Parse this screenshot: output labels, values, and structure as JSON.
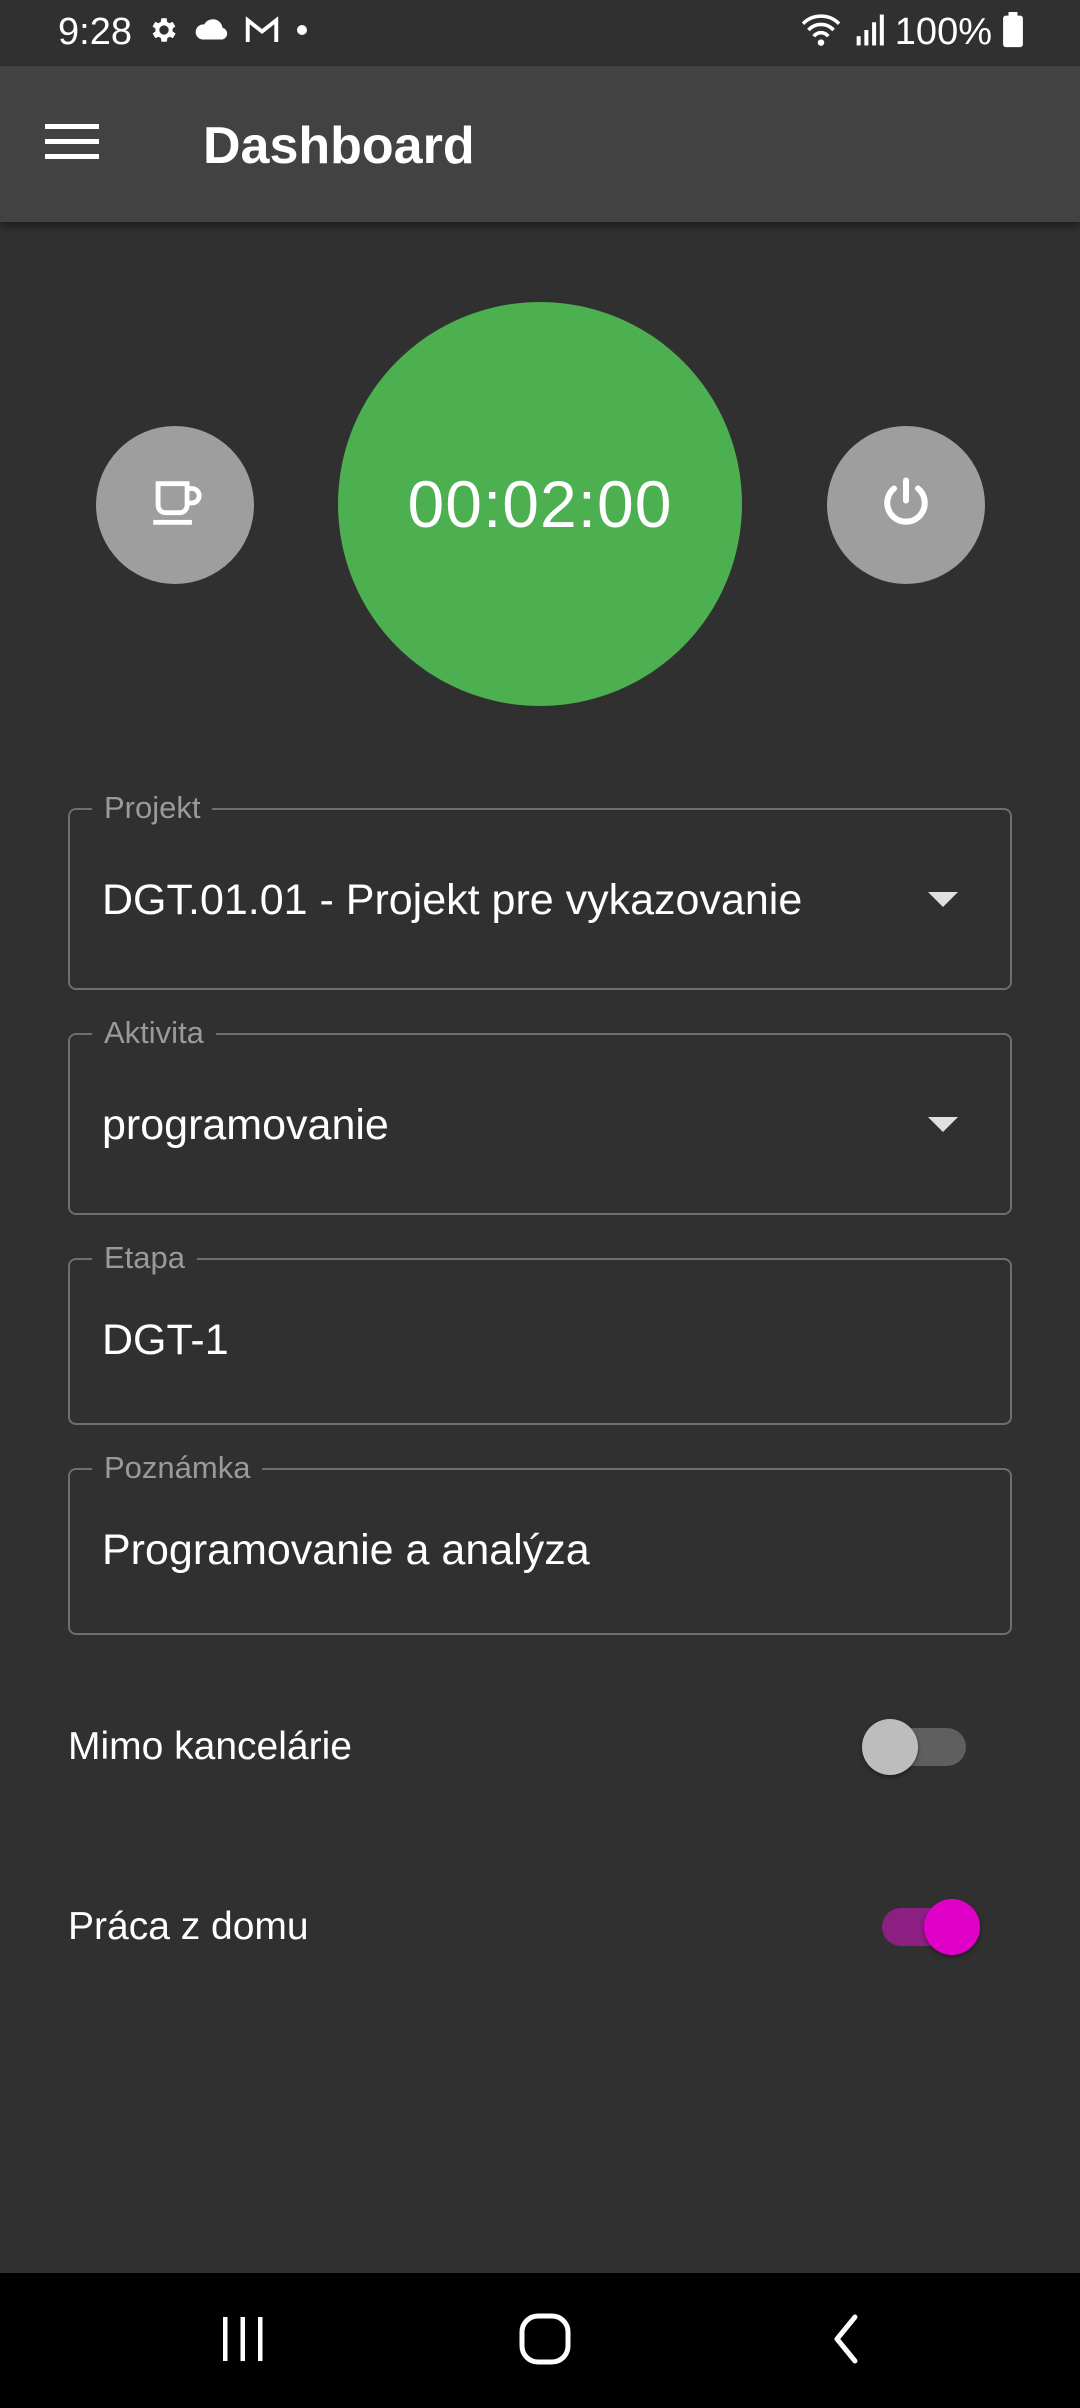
{
  "status_bar": {
    "time": "9:28",
    "left_icons": [
      "gear-icon",
      "cloud-icon",
      "gmail-icon",
      "dot-icon"
    ],
    "right_icons": [
      "wifi-icon",
      "signal-icon",
      "battery-icon"
    ],
    "battery": "100%"
  },
  "app_bar": {
    "title": "Dashboard",
    "menu_icon": "menu-icon"
  },
  "timer": {
    "value": "00:02:00",
    "color": "#4caf50",
    "left_button_icon": "coffee-cup-icon",
    "right_button_icon": "power-icon"
  },
  "form": {
    "projekt": {
      "label": "Projekt",
      "value": "DGT.01.01 - Projekt pre vykazovanie"
    },
    "aktivita": {
      "label": "Aktivita",
      "value": "programovanie"
    },
    "etapa": {
      "label": "Etapa",
      "value": "DGT-1"
    },
    "poznamka": {
      "label": "Poznámka",
      "value": "Programovanie a analýza"
    }
  },
  "switches": {
    "mimo_kancelarie": {
      "label": "Mimo kancelárie",
      "on": false
    },
    "praca_z_domu": {
      "label": "Práca z domu",
      "on": true,
      "accent": "#e100c8"
    }
  },
  "nav_bar": {
    "buttons": [
      "recents-icon",
      "home-icon",
      "back-icon"
    ]
  }
}
